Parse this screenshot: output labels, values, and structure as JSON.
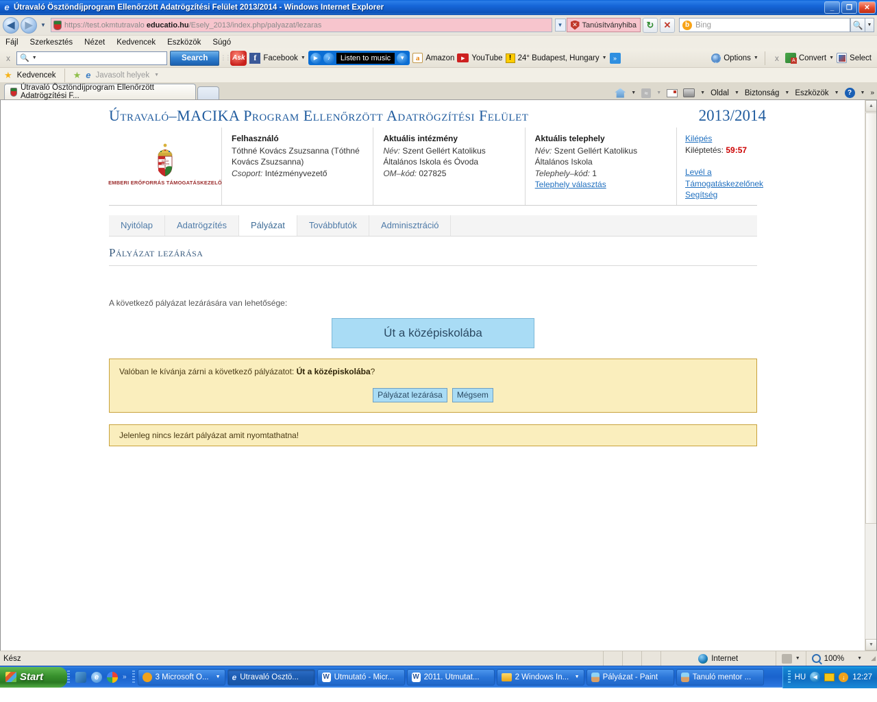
{
  "window": {
    "title": "Útravaló Ösztöndíjprogram Ellenőrzött Adatrögzítési Felület 2013/2014 - Windows Internet Explorer",
    "minimize": "_",
    "maximize": "❐",
    "close": "✕"
  },
  "address": {
    "url_prefix": "https://test.okmtutravalo ",
    "url_bold": "educatio.hu",
    "url_suffix": "/Esely_2013/index.php/palyazat/lezaras",
    "cert_error": "Tanúsítványhiba",
    "refresh": "↻",
    "stop": "✕",
    "search_placeholder": "Bing",
    "back": "◀",
    "forward": "▶"
  },
  "menubar": {
    "items": [
      "Fájl",
      "Szerkesztés",
      "Nézet",
      "Kedvencek",
      "Eszközök",
      "Súgó"
    ]
  },
  "ask_toolbar": {
    "close_x": "x",
    "query_value": "",
    "search_button": "Search",
    "ask_logo": "Ask",
    "facebook": "Facebook",
    "music": "Listen to music",
    "amazon": "Amazon",
    "youtube": "YouTube",
    "weather": "24° Budapest, Hungary",
    "more": "»",
    "options": "Options",
    "adobe_close": "x",
    "convert": "Convert",
    "select": "Select"
  },
  "favorites_bar": {
    "favorites": "Kedvencek",
    "suggested_sites": "Javasolt helyek"
  },
  "tabs": {
    "open_tab": "Útravaló Ösztöndíjprogram Ellenőrzött Adatrögzítési F...",
    "command_items": [
      "Oldal",
      "Biztonság",
      "Eszközök"
    ],
    "overflow": "»"
  },
  "page": {
    "title": "Útravaló–MACIKA Program Ellenőrzött Adatrögzítési Felület",
    "year": "2013/2014",
    "logo_caption": "EMBERI ERŐFORRÁS TÁMOGATÁSKEZELŐ",
    "info": {
      "user": {
        "heading": "Felhasználó",
        "name": "Tóthné Kovács Zsuzsanna (Tóthné Kovács Zsuzsanna)",
        "group_label": "Csoport:",
        "group_value": "Intézményvezető"
      },
      "institution": {
        "heading": "Aktuális intézmény",
        "name_label": "Név:",
        "name_value": "Szent Gellért Katolikus Általános Iskola és Óvoda",
        "om_label": "OM–kód:",
        "om_value": "027825"
      },
      "site": {
        "heading": "Aktuális telephely",
        "name_label": "Név:",
        "name_value": "Szent Gellért Katolikus Általános Iskola",
        "code_label": "Telephely–kód:",
        "code_value": "1",
        "select_link": "Telephely választás"
      },
      "session": {
        "logout_link": "Kilépés",
        "timeout_label": "Kiléptetés:",
        "timeout_value": "59:57",
        "mail_link_line1": "Levél a",
        "mail_link_line2": "Támogatáskezelőnek",
        "help_link": "Segítség"
      }
    },
    "nav_tabs": [
      {
        "label": "Nyitólap",
        "active": false
      },
      {
        "label": "Adatrögzítés",
        "active": false
      },
      {
        "label": "Pályázat",
        "active": true
      },
      {
        "label": "Továbbfutók",
        "active": false
      },
      {
        "label": "Adminisztráció",
        "active": false
      }
    ],
    "heading": "Pályázat lezárása",
    "intro": "A következő pályázat lezárására van lehetősége:",
    "program_button": "Út a középiskolába",
    "confirm": {
      "question_prefix": "Valóban le kívánja zárni a következő pályázatot: ",
      "question_bold": "Út a középiskolába",
      "question_suffix": "?",
      "confirm_button": "Pályázat lezárása",
      "cancel_button": "Mégsem"
    },
    "notice": "Jelenleg nincs lezárt pályázat amit nyomtathatna!"
  },
  "statusbar": {
    "status": "Kész",
    "zone": "Internet",
    "zoom": "100%"
  },
  "taskbar": {
    "start": "Start",
    "items": [
      {
        "label": "3 Microsoft O...",
        "active": false,
        "has_dropdown": true
      },
      {
        "label": "Útravaló Ösztö...",
        "active": true,
        "has_dropdown": false
      },
      {
        "label": "Útmutató - Micr...",
        "active": false,
        "has_dropdown": false
      },
      {
        "label": "2011. Útmutat...",
        "active": false,
        "has_dropdown": false
      },
      {
        "label": "2 Windows In...",
        "active": false,
        "has_dropdown": true
      },
      {
        "label": "Pályázat - Paint",
        "active": false,
        "has_dropdown": false
      },
      {
        "label": "Tanuló mentor ...",
        "active": false,
        "has_dropdown": false
      }
    ],
    "language": "HU",
    "clock": "12:27"
  },
  "colors": {
    "title_blue": "#1f5b9e",
    "link_blue": "#1f6fbf",
    "alert_bg": "#faeebd",
    "alert_border": "#c8a13b",
    "button_blue": "#a9dcf5",
    "timer_red": "#cc0000"
  }
}
